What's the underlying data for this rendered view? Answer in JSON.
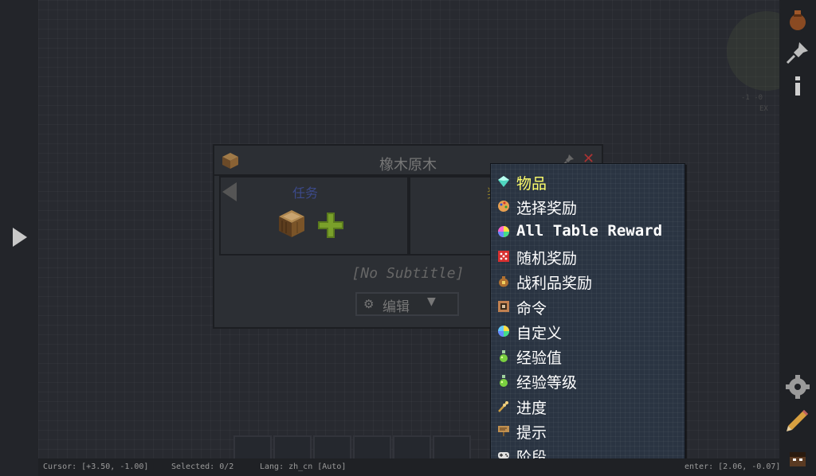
{
  "quest": {
    "title": "橡木原木",
    "task_label": "任务",
    "reward_label": "奖",
    "subtitle": "[No Subtitle]",
    "edit_label": "编辑",
    "close_glyph": "✕"
  },
  "reward_menu": {
    "items": [
      {
        "label": "物品",
        "icon": "diamond-icon",
        "color": "#4fd6c0"
      },
      {
        "label": "选择奖励",
        "icon": "palette-icon",
        "color": "#e8a050"
      },
      {
        "label": "All Table Reward",
        "icon": "rainbow-orb-icon",
        "color": "#ff66cc"
      },
      {
        "label": "随机奖励",
        "icon": "dice-icon",
        "color": "#d83030"
      },
      {
        "label": "战利品奖励",
        "icon": "money-bag-icon",
        "color": "#b07030"
      },
      {
        "label": "命令",
        "icon": "command-block-icon",
        "color": "#c08050"
      },
      {
        "label": "自定义",
        "icon": "rainbow-orb-icon",
        "color": "#66ccff"
      },
      {
        "label": "经验值",
        "icon": "xp-bottle-icon",
        "color": "#7ad040"
      },
      {
        "label": "经验等级",
        "icon": "xp-bottle-icon",
        "color": "#7ad040"
      },
      {
        "label": "进度",
        "icon": "wheat-icon",
        "color": "#d0a040"
      },
      {
        "label": "提示",
        "icon": "sign-icon",
        "color": "#c09050"
      },
      {
        "label": "阶段",
        "icon": "gamepad-icon",
        "color": "#e0e0e0"
      }
    ]
  },
  "status_bar": {
    "cursor": "Cursor: [+3.50, -1.00]",
    "selected": "Selected: 0/2",
    "lang": "Lang: zh_cn [Auto]",
    "center": "enter: [2.06, -0.07]"
  },
  "minimap": {
    "coords_line1": "-1 -0",
    "coords_line2": "EX"
  },
  "colors": {
    "menu_highlight": "#ffff6a",
    "canvas": "#2e3137",
    "menu_bg": "#2a3442"
  }
}
